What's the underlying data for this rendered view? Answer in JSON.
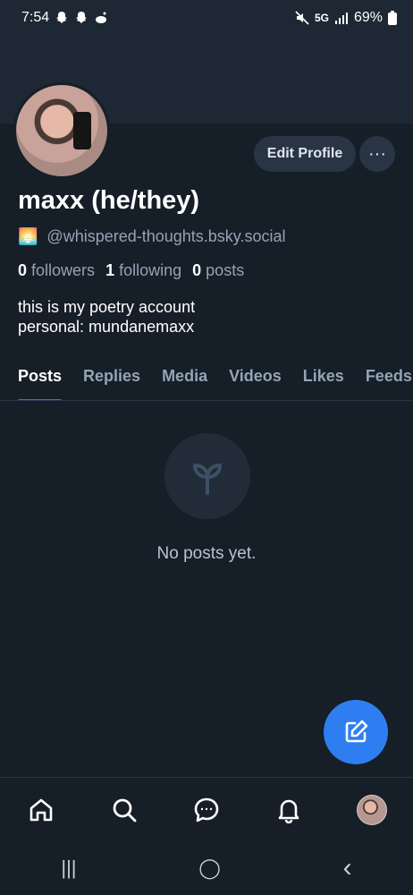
{
  "status_bar": {
    "time": "7:54",
    "network": "5G",
    "battery": "69%"
  },
  "profile": {
    "display_name": "maxx (he/they)",
    "handle": "@whispered-thoughts.bsky.social",
    "handle_emoji": "🌅",
    "stats": {
      "followers_count": "0",
      "followers_label": "followers",
      "following_count": "1",
      "following_label": "following",
      "posts_count": "0",
      "posts_label": "posts"
    },
    "bio_line1": "this is my poetry account",
    "bio_line2": "personal: mundanemaxx"
  },
  "actions": {
    "edit_label": "Edit Profile",
    "more_label": "···"
  },
  "tabs": [
    {
      "label": "Posts",
      "active": true
    },
    {
      "label": "Replies",
      "active": false
    },
    {
      "label": "Media",
      "active": false
    },
    {
      "label": "Videos",
      "active": false
    },
    {
      "label": "Likes",
      "active": false
    },
    {
      "label": "Feeds",
      "active": false
    }
  ],
  "empty_state": {
    "icon": "sprout-icon",
    "text": "No posts yet."
  },
  "fab": {
    "icon": "compose-icon"
  },
  "bottom_nav": [
    "home-icon",
    "search-icon",
    "chat-icon",
    "bell-icon",
    "profile-avatar"
  ],
  "android_nav": {
    "recents": "|||",
    "home": "◯",
    "back": "‹"
  },
  "colors": {
    "background": "#161e27",
    "accent": "#2b78e6",
    "fab": "#2f7ef1",
    "muted_text": "#93a4b6"
  }
}
